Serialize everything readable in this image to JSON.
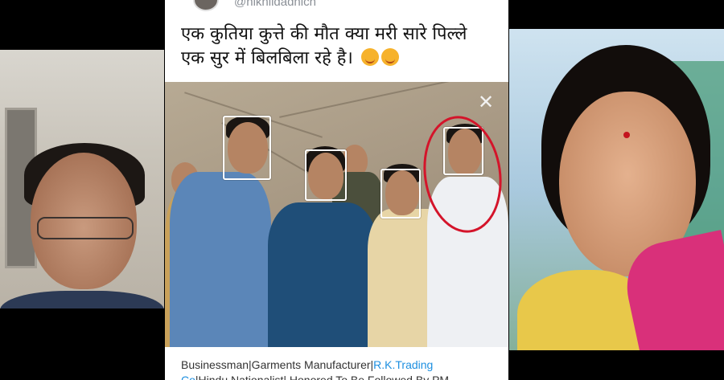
{
  "tweet": {
    "handle": "@nikhildadhich",
    "text": "एक कुतिया कुत्ते की मौत क्या मरी सारे पिल्ले एक सुर में बिलबिला रहे है।",
    "emoji_count": 2,
    "close_glyph": "✕",
    "bio_line1_plain": "Businessman|Garments Manufacturer|",
    "bio_line1_link": "R.K.Trading",
    "bio_line2_link": "Co",
    "bio_line2_plain": "|Hindu Nationalist| Honored To Be Followed By PM"
  },
  "colors": {
    "link": "#1d8fe0",
    "highlight_circle": "#d4142a",
    "card_background": "#ffffff",
    "page_background": "#000000"
  }
}
